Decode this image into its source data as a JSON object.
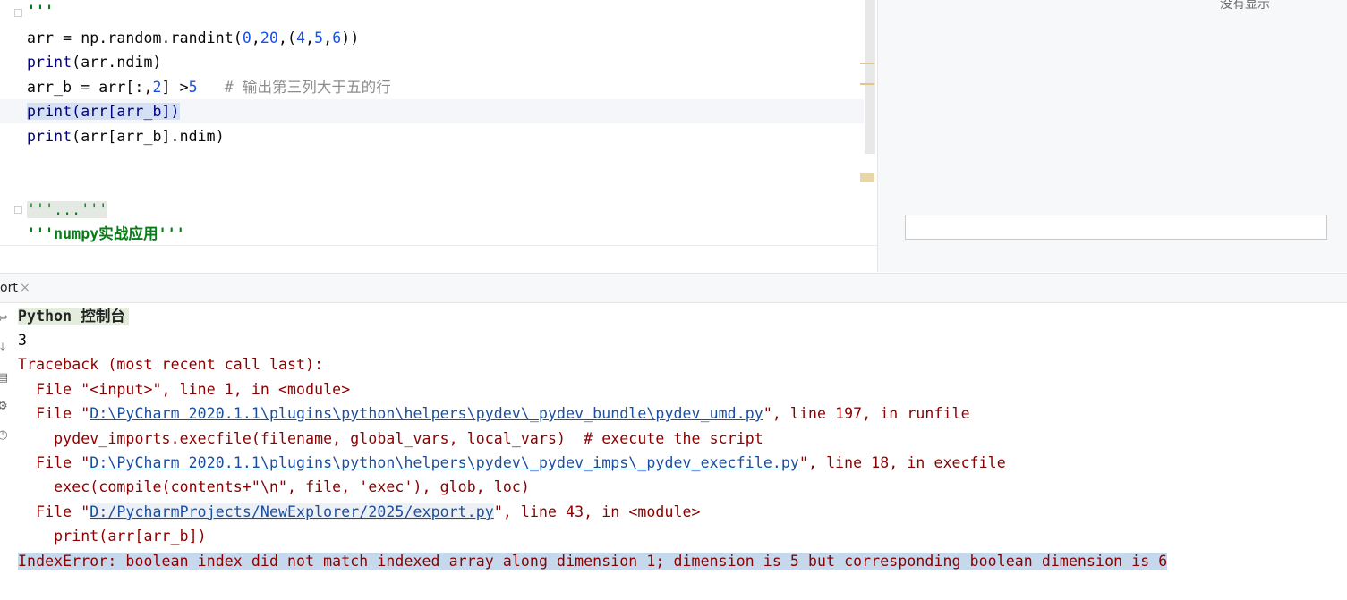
{
  "editor": {
    "line0": "'''",
    "line1": {
      "a": "arr = np.random.randint(",
      "n0": "0",
      "c1": ",",
      "n20": "20",
      "c2": ",(",
      "n4": "4",
      "c3": ",",
      "n5": "5",
      "c4": ",",
      "n6": "6",
      "end": "))"
    },
    "line2": {
      "fn": "print",
      "rest": "(arr.ndim)"
    },
    "line3": {
      "a": "arr_b = arr[:,",
      "n2": "2",
      "b": "] >",
      "n5": "5",
      "gap": "   ",
      "comment": "# 输出第三列大于五的行"
    },
    "line4": {
      "code": "print(arr[arr_b])"
    },
    "line5": {
      "fn": "print",
      "rest": "(arr[arr_b].ndim)"
    },
    "line6": {
      "folded": "'''...'''"
    },
    "line7": {
      "str": "'''numpy实战应用'''"
    }
  },
  "right_panel": {
    "no_display": "没有显示",
    "input_value": ""
  },
  "tab": {
    "label": "ort",
    "close": "×"
  },
  "console": {
    "title": "Python 控制台",
    "output_ndim": "3",
    "traceback_header": "Traceback (most recent call last):",
    "frame1": "  File \"<input>\", line 1, in <module>",
    "frame2_pre": "  File \"",
    "frame2_path": "D:\\PyCharm 2020.1.1\\plugins\\python\\helpers\\pydev\\_pydev_bundle\\pydev_umd.py",
    "frame2_post": "\", line 197, in runfile",
    "frame2_code": "    pydev_imports.execfile(filename, global_vars, local_vars)  # execute the script",
    "frame3_pre": "  File \"",
    "frame3_path": "D:\\PyCharm 2020.1.1\\plugins\\python\\helpers\\pydev\\_pydev_imps\\_pydev_execfile.py",
    "frame3_post": "\", line 18, in execfile",
    "frame3_code": "    exec(compile(contents+\"\\n\", file, 'exec'), glob, loc)",
    "frame4_pre": "  File \"",
    "frame4_path": "D:/PycharmProjects/NewExplorer/2025/export.py",
    "frame4_post": "\", line 43, in <module>",
    "frame4_code": "    print(arr[arr_b])",
    "error": "IndexError: boolean index did not match indexed array along dimension 1; dimension is 5 but corresponding boolean dimension is 6"
  },
  "toolbar_icons": [
    "soft-wrap-icon",
    "scroll-to-end-icon",
    "print-icon",
    "settings-icon",
    "history-icon"
  ],
  "colors": {
    "error_text": "#8b0000",
    "link": "#1a4fa0",
    "selection": "#c6d8ec",
    "keyword": "#000080",
    "number": "#1750eb",
    "string": "#067d17"
  }
}
